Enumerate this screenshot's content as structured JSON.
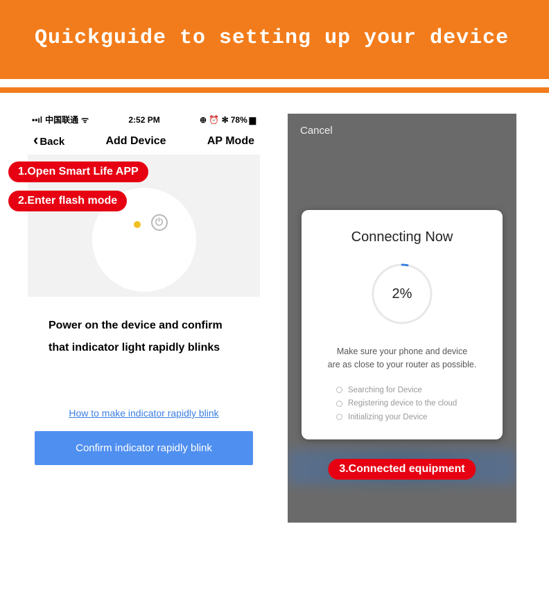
{
  "header": {
    "title": "Quickguide to setting up your device"
  },
  "left": {
    "status": {
      "carrier": "中国联通",
      "signal_prefix": "••ıl",
      "wifi": "ᯤ",
      "time": "2:52 PM",
      "icons": "⊕ ⏰ ✻",
      "battery_pct": "78%",
      "battery_icon": "▆▁"
    },
    "nav": {
      "back": "Back",
      "title": "Add Device",
      "mode": "AP Mode"
    },
    "badges": {
      "b1": "1.Open Smart Life APP",
      "b2": "2.Enter flash mode"
    },
    "instruction_l1": "Power on the device and confirm",
    "instruction_l2": "that indicator light rapidly blinks",
    "help_link": "How to make indicator rapidly blink",
    "confirm": "Confirm indicator rapidly blink"
  },
  "right": {
    "cancel": "Cancel",
    "modal": {
      "title": "Connecting Now",
      "percent": "2%",
      "sub_l1": "Make sure your phone and device",
      "sub_l2": "are as close to your router as possible.",
      "steps": [
        "Searching for Device",
        "Registering device to the cloud",
        "Initializing your Device"
      ]
    },
    "badge3": "3.Connected equipment"
  }
}
